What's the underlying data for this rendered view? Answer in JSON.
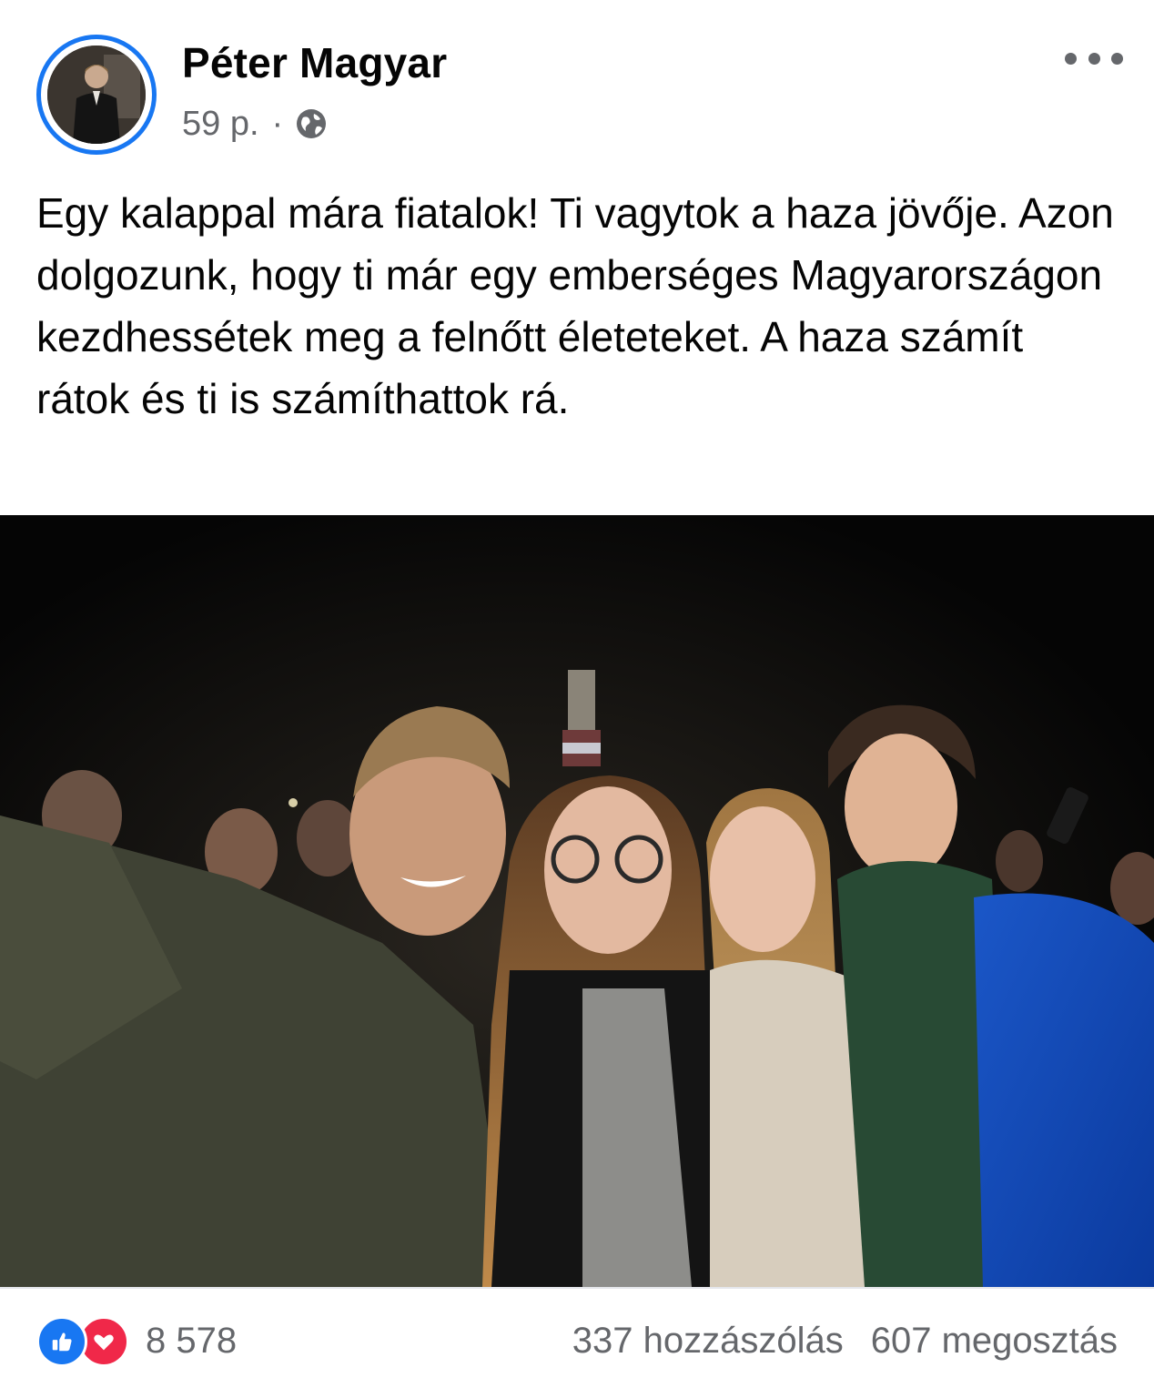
{
  "post": {
    "author": "Péter Magyar",
    "time": "59 p.",
    "separator": "·",
    "privacy_icon": "globe-icon",
    "more_icon": "more-horizontal-icon",
    "text": "Egy kalappal mára fiatalok! Ti vagytok a haza jövője. Azon dolgozunk, hogy ti már egy emberséges Magyarországon kezdhessétek meg a felnőtt életeteket. A haza számít rátok és ti is számíthattok rá.",
    "photo_icon": "group-selfie-photo"
  },
  "footer": {
    "reaction_icons": [
      "like-icon",
      "love-icon"
    ],
    "reaction_count": "8 578",
    "comments": "337 hozzászólás",
    "shares": "607 megosztás"
  },
  "colors": {
    "accent": "#1877f2",
    "love": "#f02849",
    "secondary_text": "#65676b"
  }
}
